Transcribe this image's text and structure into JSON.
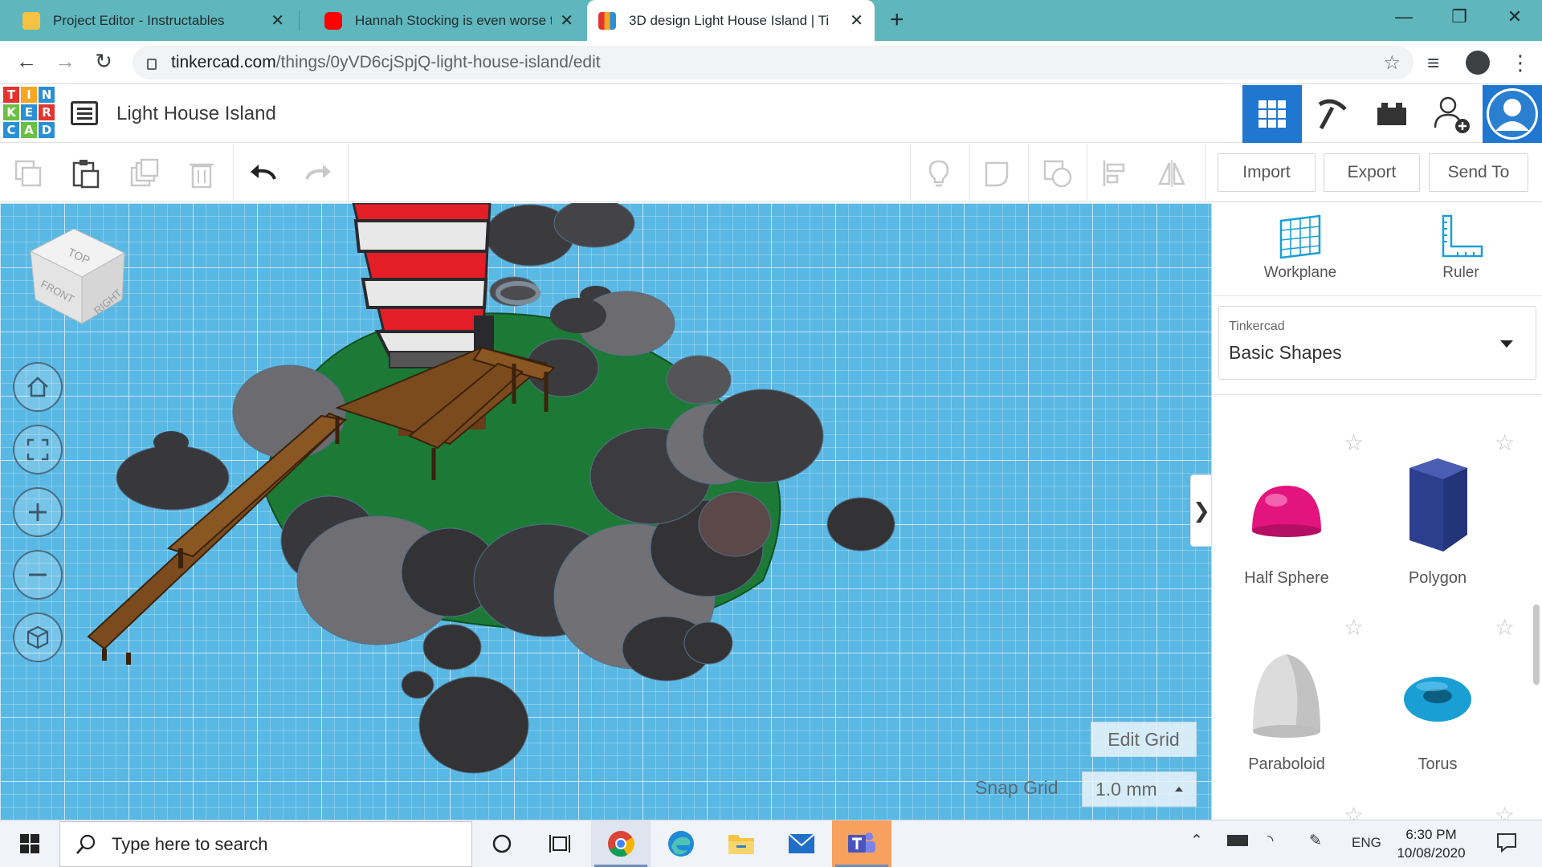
{
  "browser": {
    "tabs": [
      {
        "title": "Project Editor - Instructables",
        "active": false
      },
      {
        "title": "Hannah Stocking is even worse t",
        "active": false
      },
      {
        "title": "3D design Light House Island | Ti",
        "active": true
      }
    ],
    "url_host": "tinkercad.com",
    "url_path": "/things/0yVD6cjSpjQ-light-house-island/edit"
  },
  "app": {
    "logo_letters": [
      "T",
      "I",
      "N",
      "K",
      "E",
      "R",
      "C",
      "A",
      "D"
    ],
    "design_title": "Light House Island"
  },
  "toolbar": {
    "import_label": "Import",
    "export_label": "Export",
    "sendto_label": "Send To"
  },
  "viewcube": {
    "top": "TOP",
    "front": "FRONT",
    "right": "RIGHT"
  },
  "grid": {
    "edit_grid_label": "Edit Grid",
    "snap_grid_label": "Snap Grid",
    "snap_grid_value": "1.0 mm"
  },
  "panel": {
    "workplane_label": "Workplane",
    "ruler_label": "Ruler",
    "library_source": "Tinkercad",
    "library_name": "Basic Shapes",
    "shapes": [
      {
        "name": "Half Sphere",
        "color": "#e3147d"
      },
      {
        "name": "Polygon",
        "color": "#2c3f8f"
      },
      {
        "name": "Paraboloid",
        "color": "#d9d9d9"
      },
      {
        "name": "Torus",
        "color": "#1a9fd4"
      }
    ]
  },
  "taskbar": {
    "search_placeholder": "Type here to search",
    "language": "ENG",
    "time": "6:30 PM",
    "date": "10/08/2020"
  },
  "colors": {
    "tab_strip": "#5fb7bd",
    "tinkercad_blue": "#1f77d0",
    "workplane": "#5ab8e4"
  }
}
